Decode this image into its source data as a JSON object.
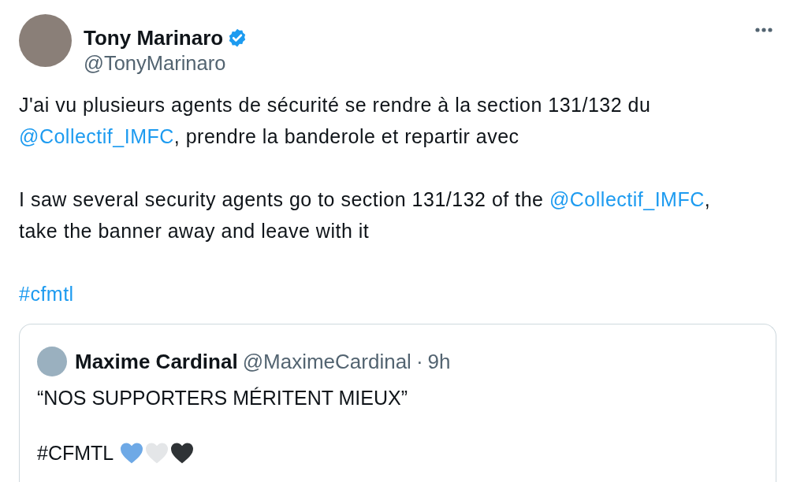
{
  "author": {
    "name": "Tony Marinaro",
    "verified": true,
    "handle": "@TonyMarinaro"
  },
  "body": [
    {
      "segments": [
        {
          "kind": "text",
          "text": "J'ai vu plusieurs agents de sécurité se rendre à la section 131/132 du "
        },
        {
          "kind": "mention",
          "text": "@Collectif_IMFC"
        },
        {
          "kind": "text",
          "text": ", prendre la banderole et repartir avec"
        }
      ]
    },
    {
      "segments": [
        {
          "kind": "text",
          "text": "I saw several security agents go to section 131/132 of the "
        },
        {
          "kind": "mention",
          "text": "@Collectif_IMFC"
        },
        {
          "kind": "text",
          "text": ", take the banner away and leave with it"
        }
      ]
    },
    {
      "segments": [
        {
          "kind": "hashtag",
          "text": "#cfmtl"
        }
      ]
    }
  ],
  "quote": {
    "name": "Maxime Cardinal",
    "handle": "@MaximeCardinal",
    "separator": "·",
    "time": "9h",
    "lines": [
      "“NOS SUPPORTERS MÉRITENT MIEUX”",
      "#CFMTL"
    ],
    "hearts": [
      {
        "color": "#6ea9e6"
      },
      {
        "color": "#e4e6e8"
      },
      {
        "color": "#2f3336"
      }
    ]
  }
}
